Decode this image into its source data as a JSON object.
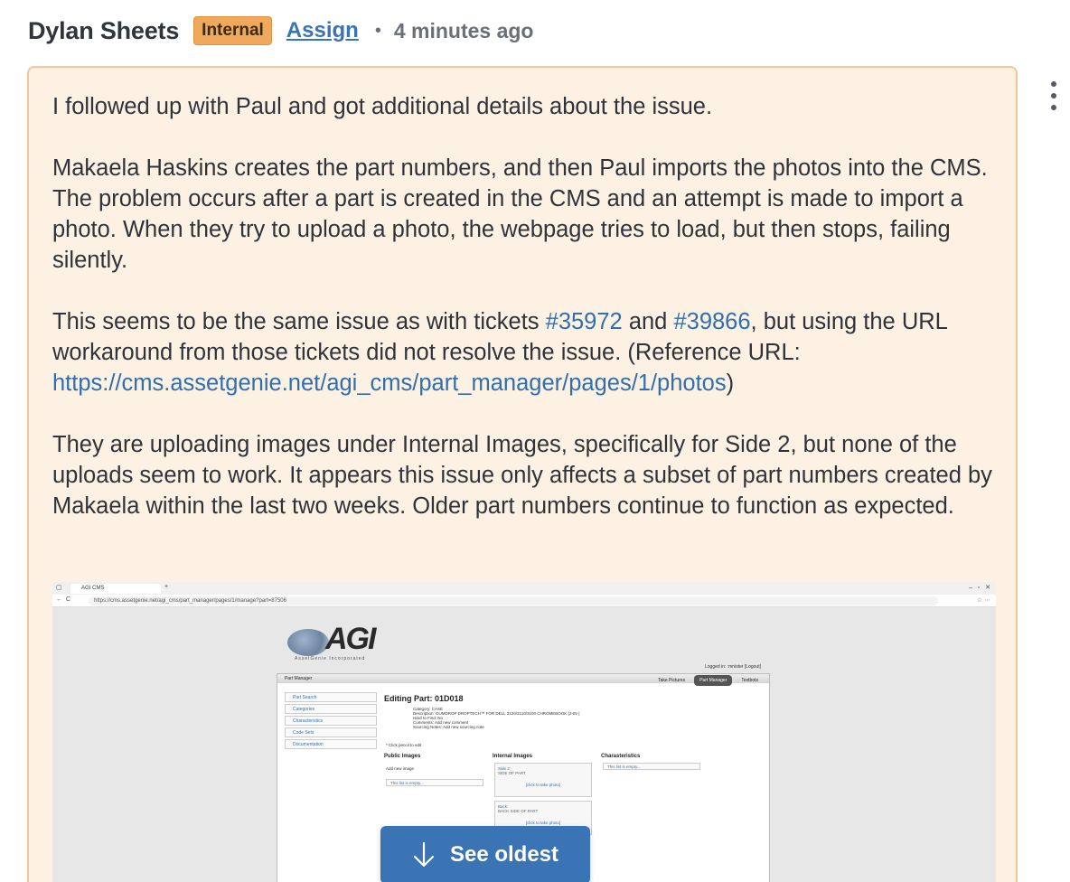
{
  "comment": {
    "author": "Dylan Sheets",
    "badge": "Internal",
    "assign_label": "Assign",
    "separator": "•",
    "timestamp": "4 minutes ago",
    "paragraphs": {
      "p1": "I followed up with Paul and got additional details about the issue.",
      "p2": "Makaela Haskins creates the part numbers, and then Paul imports the photos into the CMS. The problem occurs after a part is created in the CMS and an attempt is made to import a photo. When they try to upload a photo, the webpage tries to load, but then stops, failing silently.",
      "p3_a": "This seems to be the same issue as with tickets ",
      "p3_link1": "#35972",
      "p3_b": " and ",
      "p3_link2": "#39866",
      "p3_c": ", but using the URL workaround from those tickets did not resolve the issue. (Reference URL: ",
      "p3_url": "https://cms.assetgenie.net/agi_cms/part_manager/pages/1/photos",
      "p3_d": ")",
      "p4": "They are uploading images under Internal Images, specifically for Side 2, but none of the uploads seem to work. It appears this issue only affects a subset of part numbers created by Makaela within the last two weeks. Older part numbers continue to function as expected."
    }
  },
  "screenshot": {
    "tab_title": "AGI CMS",
    "url": "https://cms.assetgenie.net/agi_cms/part_manager/pages/1/manage?part=87506",
    "logo_text": "AGI",
    "logo_sub": "AssetGenie Incorporated",
    "logged_in": "Logged in: :mnister [Logout]",
    "panel_title": "Part Manager",
    "tabs": [
      "Take Pictures",
      "Part Manager",
      "Textbots"
    ],
    "nav": [
      "Part Search",
      "Categories",
      "Characteristics",
      "Code Sets",
      "Documentation"
    ],
    "editing": "Editing Part: 01D018",
    "fields": {
      "f1": "Category: CASE",
      "f2": "Description: GUMDROP DROPTECH™ FOR DELL 3120/3110/3100 CHROMEBOOK (2-IN-)",
      "f3": "Hard to Find: No",
      "f4": "Comments: Add new comment",
      "f5": "Sourcing Notes: Add new sourcing note"
    },
    "click_note": "* Click pencil to edit",
    "public_images": "Public Images",
    "add_image": "Add new image",
    "list_empty": "This list is empty...",
    "internal_images": "Internal Images",
    "side2": "Side 2:",
    "side2_sub": "SIDE OF PART",
    "click_photo": "[click to take photo]",
    "back": "Back:",
    "back_sub": "BACK SIDE OF PART",
    "characteristics": "Charasteristics"
  },
  "see_oldest_label": "See oldest",
  "colors": {
    "badge": "#f0a95c",
    "link": "#2f6fb0",
    "note_bg": "#fcf1e3",
    "note_border": "#f3c79a",
    "button": "#3a74b5"
  }
}
